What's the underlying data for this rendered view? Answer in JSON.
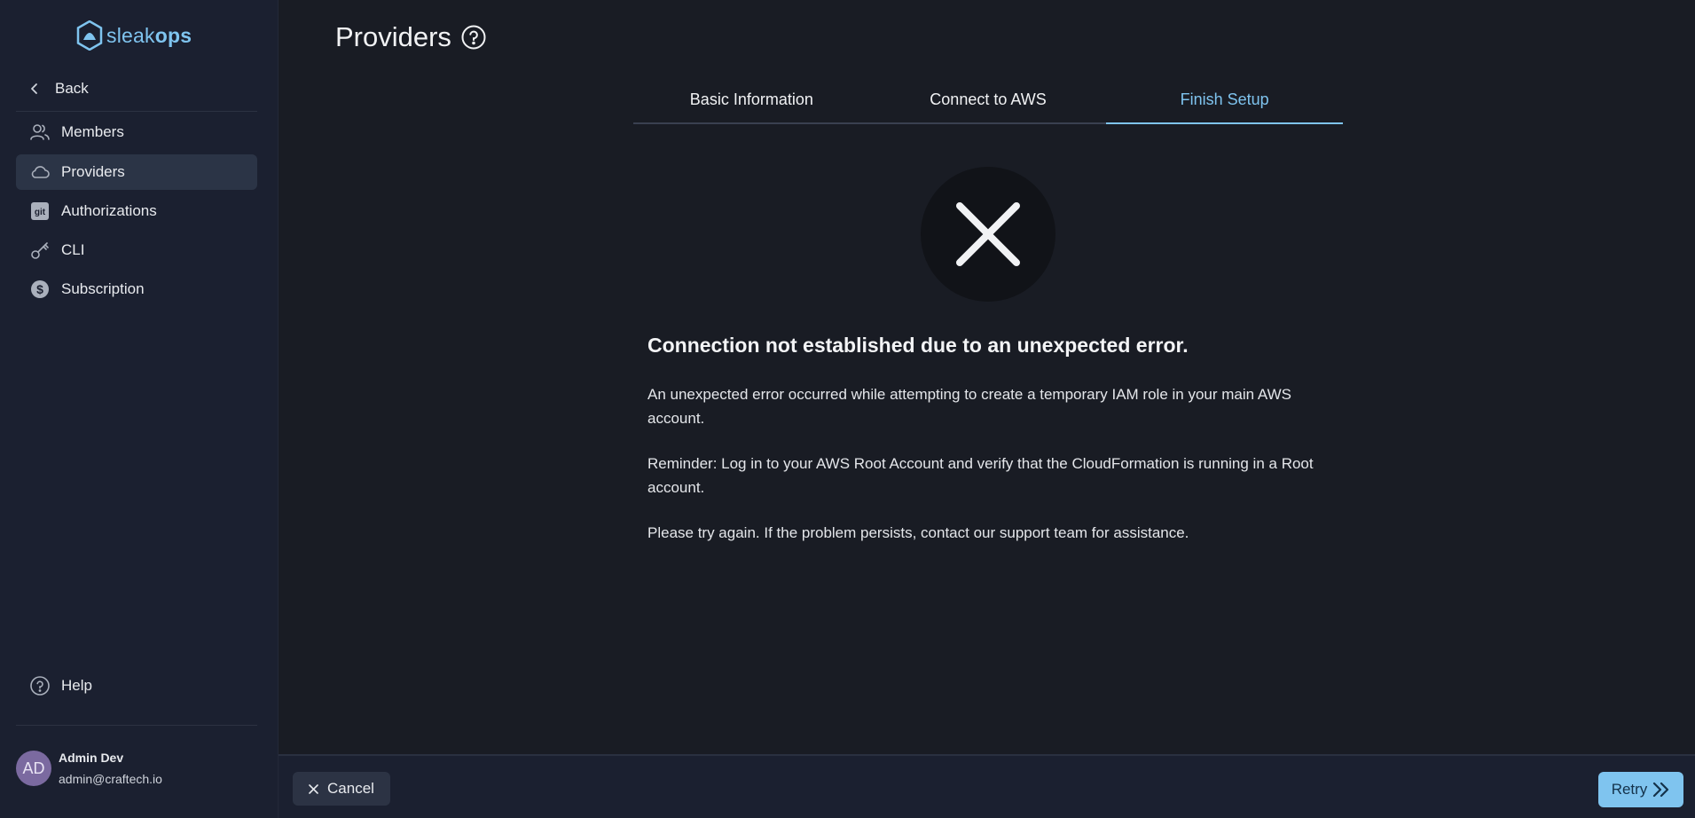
{
  "app": {
    "logo_light": "sleak",
    "logo_bold": "ops"
  },
  "sidebar": {
    "back_label": "Back",
    "items": [
      {
        "label": "Members",
        "icon": "users-icon"
      },
      {
        "label": "Providers",
        "icon": "cloud-icon",
        "active": true
      },
      {
        "label": "Authorizations",
        "icon": "git-icon"
      },
      {
        "label": "CLI",
        "icon": "key-icon"
      },
      {
        "label": "Subscription",
        "icon": "dollar-icon"
      }
    ],
    "help_label": "Help",
    "user": {
      "initials": "AD",
      "name": "Admin Dev",
      "email": "admin@craftech.io"
    }
  },
  "header": {
    "title": "Providers"
  },
  "tabs": [
    {
      "label": "Basic Information"
    },
    {
      "label": "Connect to AWS"
    },
    {
      "label": "Finish Setup",
      "active": true
    }
  ],
  "error": {
    "title": "Connection not established due to an unexpected error.",
    "paragraph_1": "An unexpected error occurred while attempting to create a temporary IAM role in your main AWS account.",
    "paragraph_2": "Reminder: Log in to your AWS Root Account and verify that the CloudFormation is running in a Root account.",
    "paragraph_3": "Please try again. If the problem persists, contact our support team for assistance."
  },
  "footer": {
    "cancel_label": "Cancel",
    "retry_label": "Retry"
  },
  "colors": {
    "accent": "#7fc4ef",
    "background": "#191c24",
    "sidebar": "#1b2030",
    "active_item": "#2b3446"
  }
}
